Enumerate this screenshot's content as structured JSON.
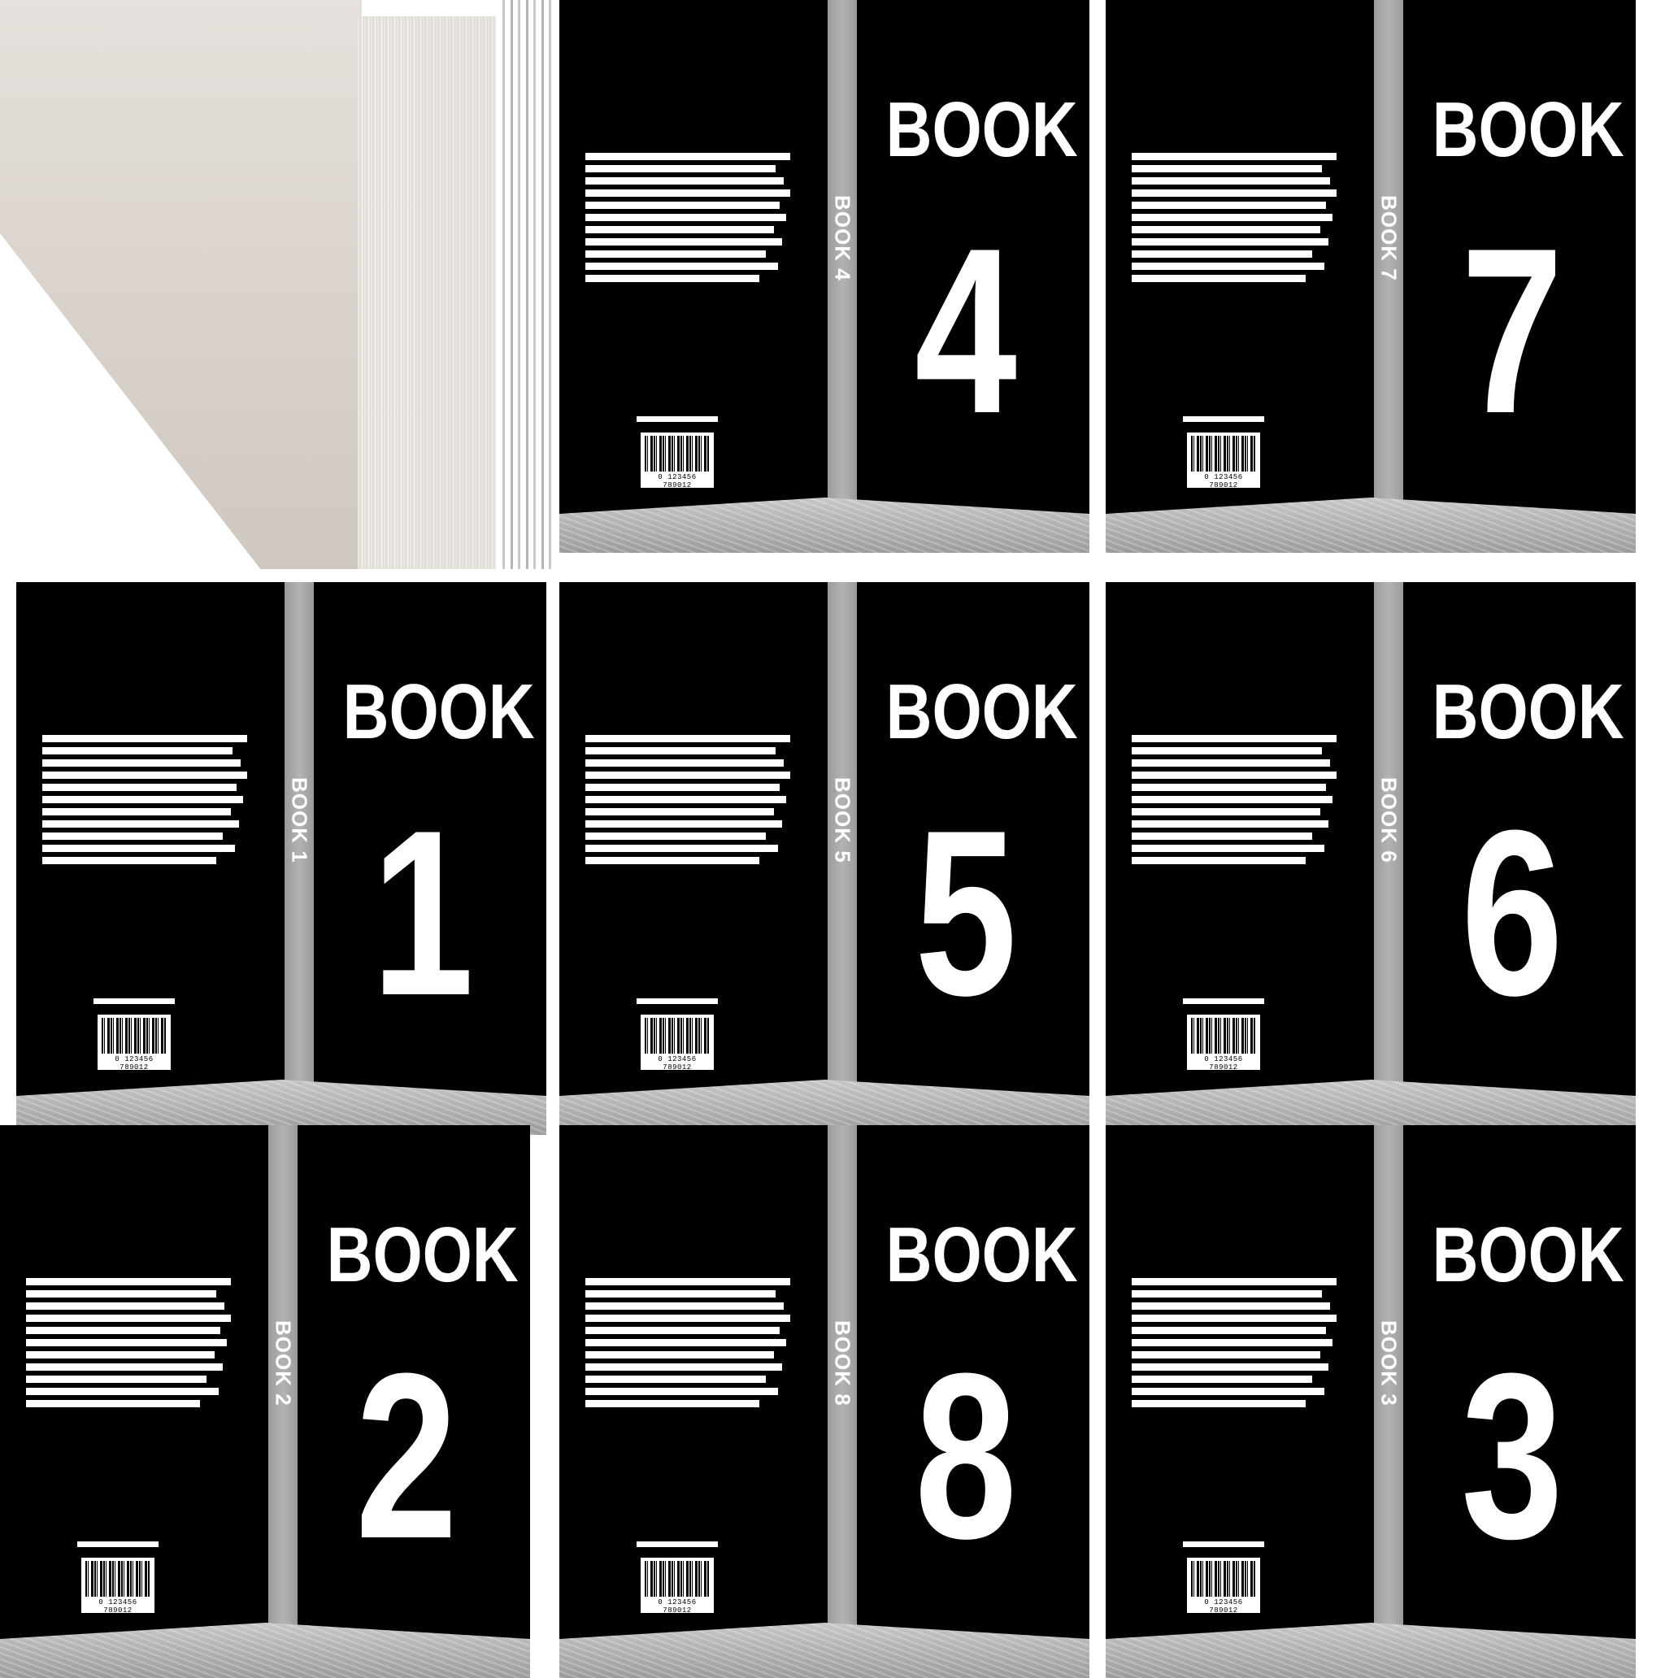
{
  "sheet": {
    "background_color": "#ffffff",
    "cover_color": "#000000",
    "spine_color": "#a6a6a6",
    "text_color": "#ffffff"
  },
  "books": [
    {
      "title_word": "BOOK",
      "number": "4",
      "spine_label": "BOOK 4",
      "barcode_digits": "0 123456 789012"
    },
    {
      "title_word": "BOOK",
      "number": "7",
      "spine_label": "BOOK 7",
      "barcode_digits": "0 123456 789012"
    },
    {
      "title_word": "BOOK",
      "number": "1",
      "spine_label": "BOOK 1",
      "barcode_digits": "0 123456 789012"
    },
    {
      "title_word": "BOOK",
      "number": "5",
      "spine_label": "BOOK 5",
      "barcode_digits": "0 123456 789012"
    },
    {
      "title_word": "BOOK",
      "number": "6",
      "spine_label": "BOOK 6",
      "barcode_digits": "0 123456 789012"
    },
    {
      "title_word": "BOOK",
      "number": "2",
      "spine_label": "BOOK 2",
      "barcode_digits": "0 123456 789012"
    },
    {
      "title_word": "BOOK",
      "number": "8",
      "spine_label": "BOOK 8",
      "barcode_digits": "0 123456 789012"
    },
    {
      "title_word": "BOOK",
      "number": "3",
      "spine_label": "BOOK 3",
      "barcode_digits": "0 123456 789012"
    }
  ]
}
